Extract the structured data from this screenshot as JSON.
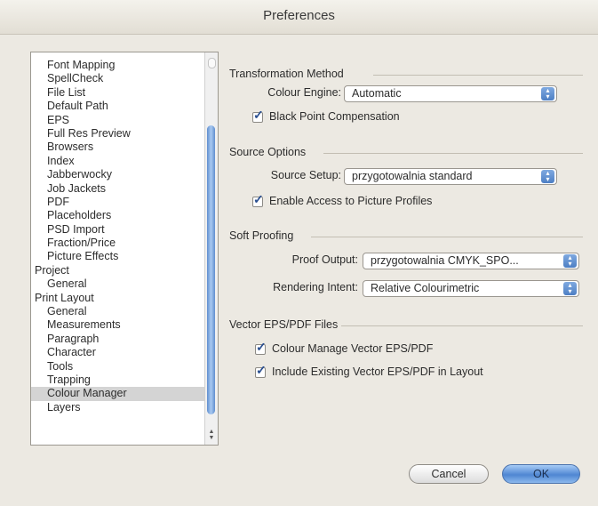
{
  "window": {
    "title": "Preferences"
  },
  "sidebar": {
    "items": [
      {
        "label": "Font Mapping",
        "level": 1,
        "selected": false
      },
      {
        "label": "SpellCheck",
        "level": 1,
        "selected": false
      },
      {
        "label": "File List",
        "level": 1,
        "selected": false
      },
      {
        "label": "Default Path",
        "level": 1,
        "selected": false
      },
      {
        "label": "EPS",
        "level": 1,
        "selected": false
      },
      {
        "label": "Full Res Preview",
        "level": 1,
        "selected": false
      },
      {
        "label": "Browsers",
        "level": 1,
        "selected": false
      },
      {
        "label": "Index",
        "level": 1,
        "selected": false
      },
      {
        "label": "Jabberwocky",
        "level": 1,
        "selected": false
      },
      {
        "label": "Job Jackets",
        "level": 1,
        "selected": false
      },
      {
        "label": "PDF",
        "level": 1,
        "selected": false
      },
      {
        "label": "Placeholders",
        "level": 1,
        "selected": false
      },
      {
        "label": "PSD Import",
        "level": 1,
        "selected": false
      },
      {
        "label": "Fraction/Price",
        "level": 1,
        "selected": false
      },
      {
        "label": "Picture Effects",
        "level": 1,
        "selected": false
      },
      {
        "label": "Project",
        "level": 0,
        "selected": false
      },
      {
        "label": "General",
        "level": 1,
        "selected": false
      },
      {
        "label": "Print Layout",
        "level": 0,
        "selected": false
      },
      {
        "label": "General",
        "level": 1,
        "selected": false
      },
      {
        "label": "Measurements",
        "level": 1,
        "selected": false
      },
      {
        "label": "Paragraph",
        "level": 1,
        "selected": false
      },
      {
        "label": "Character",
        "level": 1,
        "selected": false
      },
      {
        "label": "Tools",
        "level": 1,
        "selected": false
      },
      {
        "label": "Trapping",
        "level": 1,
        "selected": false
      },
      {
        "label": "Colour Manager",
        "level": 1,
        "selected": true
      },
      {
        "label": "Layers",
        "level": 1,
        "selected": false
      }
    ]
  },
  "transformation": {
    "title": "Transformation Method",
    "engine_label": "Colour Engine:",
    "engine_value": "Automatic",
    "bpc_label": "Black Point Compensation",
    "bpc_checked": true
  },
  "source": {
    "title": "Source Options",
    "setup_label": "Source Setup:",
    "setup_value": "przygotowalnia standard",
    "access_label": "Enable Access to Picture Profiles",
    "access_checked": true
  },
  "proofing": {
    "title": "Soft Proofing",
    "output_label": "Proof Output:",
    "output_value": "przygotowalnia CMYK_SPO...",
    "intent_label": "Rendering Intent:",
    "intent_value": "Relative Colourimetric"
  },
  "vector": {
    "title": "Vector EPS/PDF Files",
    "manage_label": "Colour Manage Vector EPS/PDF",
    "manage_checked": true,
    "include_label": "Include Existing Vector EPS/PDF in Layout",
    "include_checked": true
  },
  "buttons": {
    "cancel": "Cancel",
    "ok": "OK"
  }
}
